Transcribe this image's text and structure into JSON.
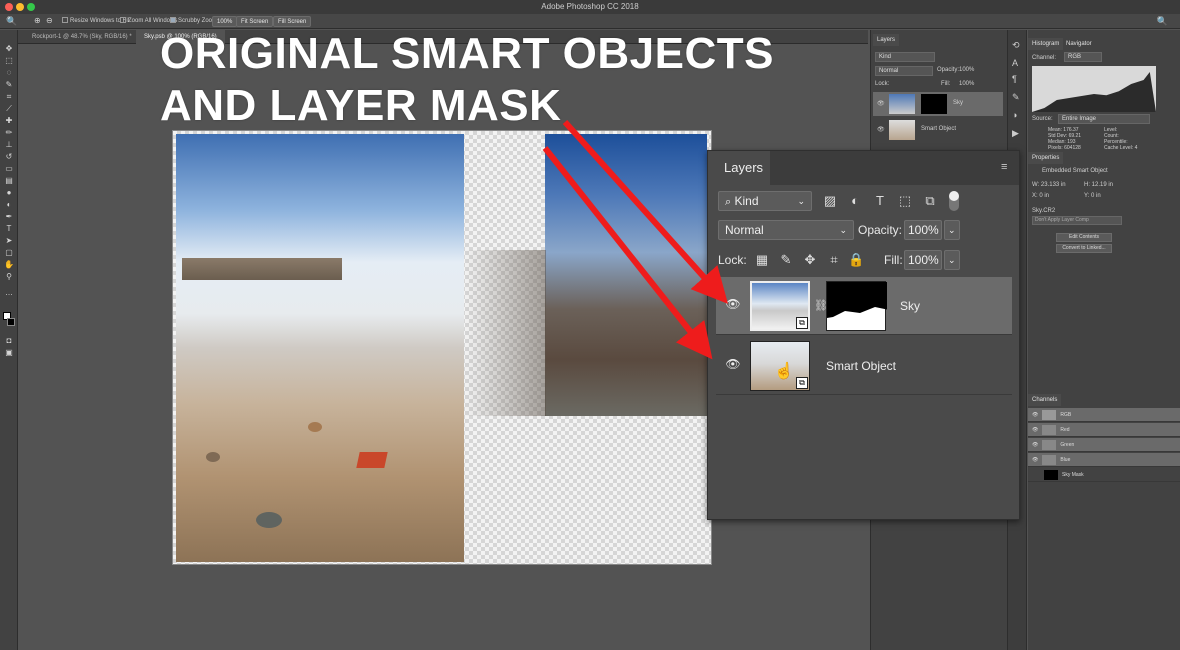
{
  "window": {
    "title": "Adobe Photoshop CC 2018",
    "traffic_colors": [
      "#fc5f57",
      "#fdbc2e",
      "#34c84a"
    ]
  },
  "options_bar": {
    "zoom_icon": "magnifier-icon",
    "resize_windows": "Resize Windows to Fit",
    "zoom_all_windows": "Zoom All Windows",
    "scrubby_zoom": "Scrubby Zoom",
    "zoom_percent": "100%",
    "fit_screen": "Fit Screen",
    "fill_screen": "Fill Screen"
  },
  "doc_tabs": [
    {
      "label": "Rockport-1 @ 48.7% (Sky, RGB/16) *",
      "active": false
    },
    {
      "label": "Sky.psb @ 100% (RGB/16)",
      "active": true
    }
  ],
  "headline": {
    "line1": "ORIGINAL SMART OBJECTS",
    "line2": "AND LAYER MASK"
  },
  "arrow_color": "#ee1c1c",
  "layers_small": {
    "title": "Layers",
    "kind": "Kind",
    "blend": "Normal",
    "opacity_label": "Opacity:",
    "opacity": "100%",
    "lock_label": "Lock:",
    "fill_label": "Fill:",
    "fill": "100%",
    "layers": [
      {
        "name": "Sky"
      },
      {
        "name": "Smart Object"
      }
    ]
  },
  "histogram": {
    "tabs": [
      "Histogram",
      "Navigator"
    ],
    "channel_label": "Channel:",
    "channel": "RGB",
    "source_label": "Source:",
    "source": "Entire Image",
    "stats_left": [
      [
        "Mean:",
        "176.37"
      ],
      [
        "Std Dev:",
        "69.21"
      ],
      [
        "Median:",
        "193"
      ],
      [
        "Pixels:",
        "604128"
      ]
    ],
    "stats_right": [
      [
        "Level:",
        ""
      ],
      [
        "Count:",
        ""
      ],
      [
        "Percentile:",
        ""
      ],
      [
        "Cache Level:",
        "4"
      ]
    ]
  },
  "properties": {
    "title": "Properties",
    "type": "Embedded Smart Object",
    "w_label": "W:",
    "w": "23.133 in",
    "h_label": "H:",
    "h": "12.19 in",
    "x_label": "X:",
    "x": "0 in",
    "y_label": "Y:",
    "y": "0 in",
    "file": "Sky.CR2",
    "comp": "Don't Apply Layer Comp",
    "edit_contents": "Edit Contents",
    "convert_linked": "Convert to Linked..."
  },
  "channels": {
    "title": "Channels",
    "rows": [
      "RGB",
      "Red",
      "Green",
      "Blue",
      "Sky Mask"
    ]
  },
  "layers_big": {
    "title": "Layers",
    "kind": "Kind",
    "blend": "Normal",
    "opacity_label": "Opacity:",
    "opacity": "100%",
    "lock_label": "Lock:",
    "fill_label": "Fill:",
    "fill": "100%",
    "layers": [
      {
        "name": "Sky",
        "selected": true
      },
      {
        "name": "Smart Object",
        "selected": false
      }
    ]
  },
  "toolbar_icons": [
    "move-tool-icon",
    "marquee-tool-icon",
    "lasso-tool-icon",
    "quick-select-icon",
    "crop-tool-icon",
    "eyedropper-icon",
    "healing-brush-icon",
    "brush-tool-icon",
    "clone-stamp-icon",
    "history-brush-icon",
    "eraser-icon",
    "gradient-tool-icon",
    "blur-tool-icon",
    "dodge-tool-icon",
    "pen-tool-icon",
    "type-tool-icon",
    "path-select-icon",
    "shape-tool-icon",
    "hand-tool-icon",
    "zoom-tool-icon"
  ]
}
